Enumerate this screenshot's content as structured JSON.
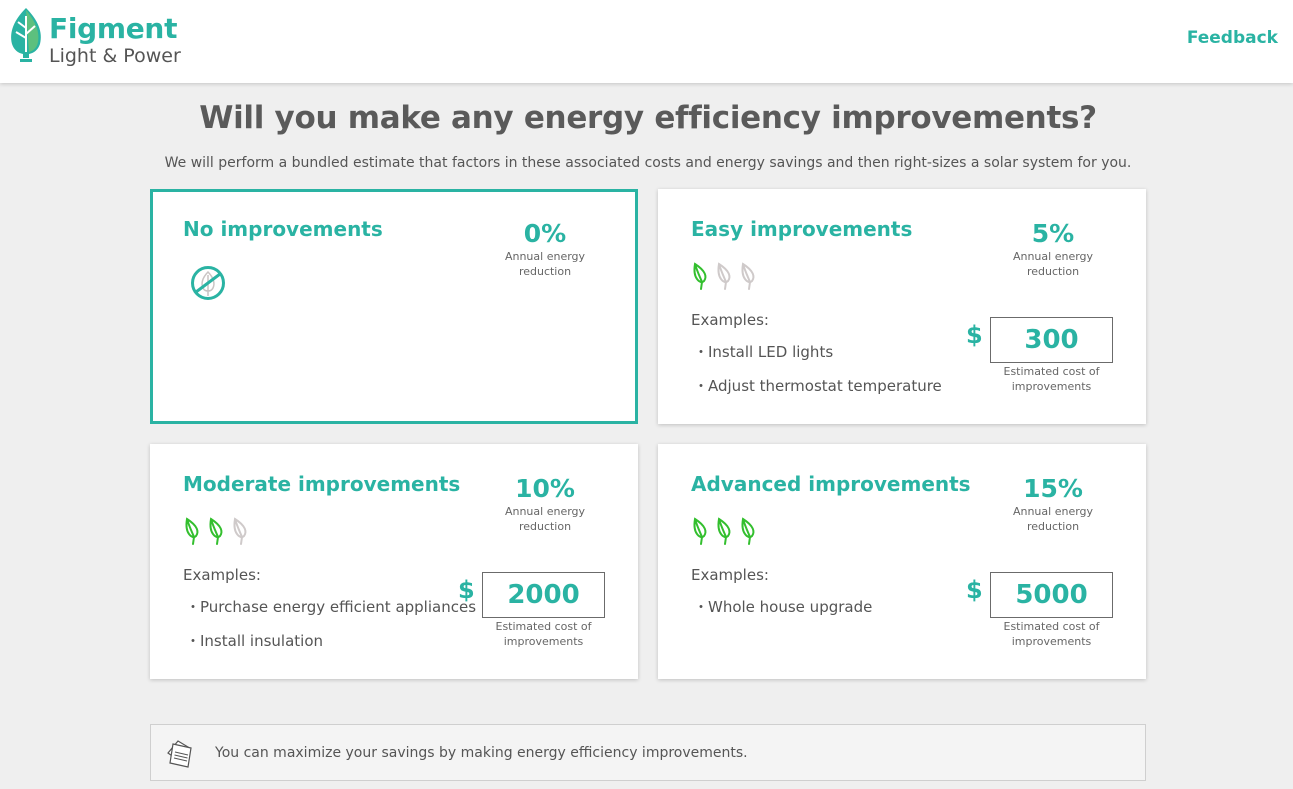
{
  "header": {
    "brand_name": "Figment",
    "brand_sub": "Light & Power",
    "feedback_label": "Feedback"
  },
  "colors": {
    "accent": "#2ab3a3",
    "leaf_active": "#33bf2e",
    "leaf_inactive": "#cfcaca",
    "text": "#555555",
    "background": "#efefef"
  },
  "page": {
    "title": "Will you make any energy efficiency improvements?",
    "subtitle": "We will perform a bundled estimate that factors in these associated costs and energy savings and then right-sizes a solar system for you."
  },
  "options": [
    {
      "title": "No improvements",
      "percent": "0%",
      "percent_label": "Annual energy reduction",
      "icon": "no-leaf-icon",
      "selected": true,
      "leaves_active": 0,
      "leaves_total": 3
    },
    {
      "title": "Easy improvements",
      "percent": "5%",
      "percent_label": "Annual energy reduction",
      "selected": false,
      "leaves_active": 1,
      "leaves_total": 3,
      "examples_label": "Examples:",
      "examples": [
        "Install LED lights",
        "Adjust thermostat temperature"
      ],
      "currency": "$",
      "cost": "300",
      "cost_label": "Estimated cost of improvements"
    },
    {
      "title": "Moderate improvements",
      "percent": "10%",
      "percent_label": "Annual energy reduction",
      "selected": false,
      "leaves_active": 2,
      "leaves_total": 3,
      "examples_label": "Examples:",
      "examples": [
        "Purchase energy efficient appliances",
        "Install insulation"
      ],
      "currency": "$",
      "cost": "2000",
      "cost_label": "Estimated cost of improvements"
    },
    {
      "title": "Advanced improvements",
      "percent": "15%",
      "percent_label": "Annual energy reduction",
      "selected": false,
      "leaves_active": 3,
      "leaves_total": 3,
      "examples_label": "Examples:",
      "examples": [
        "Whole house upgrade"
      ],
      "currency": "$",
      "cost": "5000",
      "cost_label": "Estimated cost of improvements"
    }
  ],
  "tip": {
    "icon": "notes-icon",
    "text": "You can maximize your savings by making energy efficiency improvements."
  }
}
